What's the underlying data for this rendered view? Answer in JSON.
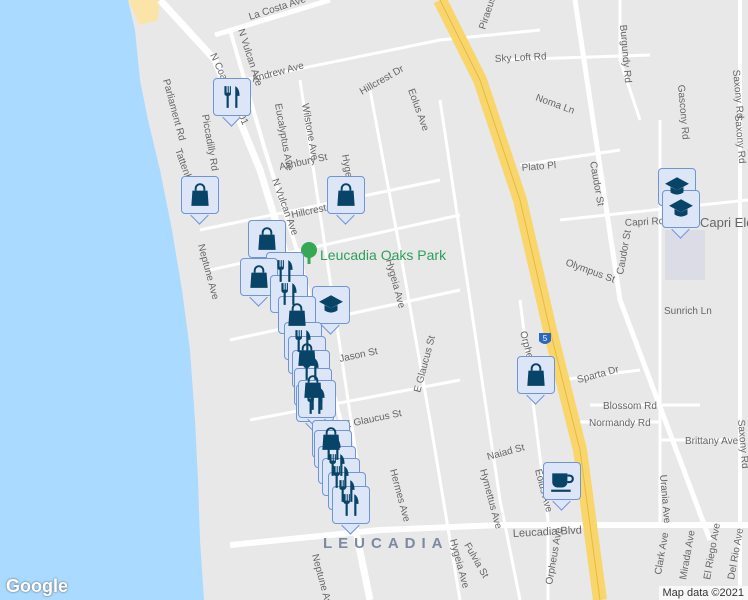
{
  "map": {
    "colors": {
      "water": "#aadaff",
      "land": "#e8e8e8",
      "road": "#ffffff",
      "highway": "#f8d66b",
      "marker": "#084467",
      "marker_bg": "#dde6f7",
      "park": "#34a853"
    },
    "streets": [
      "La Costa Ave",
      "Piraeus St",
      "Sky Loft Rd",
      "Burgundy Rd",
      "Saxony Rd",
      "N Vulcan Ave",
      "N Coast Hwy 101",
      "Andrew Ave",
      "Hillcrest Dr",
      "Eolus Ave",
      "Noma Ln",
      "Parliament Rd",
      "Piccadilly Rd",
      "Eucalyptus Ave",
      "Wilstone Ave",
      "Ashbury St",
      "Hygeia Ave",
      "Plato Pl",
      "Caudor St",
      "Gascony Rd",
      "Tattenham Rd",
      "N Vulcan Ave",
      "Hillcrest Dr",
      "Capri Rd",
      "Neptune Ave",
      "Olympus St",
      "Sunrich Ln",
      "Jason St",
      "Orpheus Ave",
      "Sparta Dr",
      "Blossom Rd",
      "Normandy Rd",
      "Brittany Ave",
      "E Glaucus St",
      "E Glaucus St",
      "Naiad St",
      "Hermes Ave",
      "Hymettus Ave",
      "Eolus Ave",
      "Urania Ave",
      "Leucadia Blvd",
      "Hygeia Ave",
      "Fulvia St",
      "Orpheus Ave",
      "Clark Ave",
      "Mirada Ave",
      "El Riego Ave",
      "Del Rio Ave",
      "Neptune Ave",
      "Saxony Rd",
      "Caudor St",
      "Hygeia Ave",
      "Saxony Rd"
    ],
    "park_name": "Leucadia Oaks Park",
    "school_name": "Capri Elem",
    "city_label": "LEUCADIA",
    "highway_shield": "5",
    "logo": "Google",
    "attribution": "Map data ©2021"
  },
  "markers": [
    "restaurant",
    "shop",
    "shop",
    "shop",
    "restaurant",
    "shop",
    "restaurant",
    "school",
    "shop",
    "restaurant",
    "shop",
    "restaurant",
    "shop",
    "restaurant",
    "restaurant",
    "shop",
    "restaurant",
    "restaurant",
    "restaurant",
    "restaurant",
    "restaurant",
    "school",
    "school",
    "shop",
    "cafe"
  ]
}
